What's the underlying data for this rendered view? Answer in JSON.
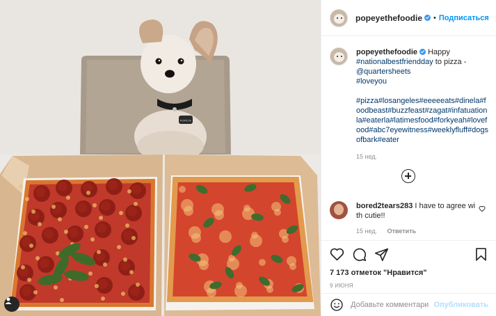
{
  "post": {
    "username": "popeyethefoodie",
    "separator": "•",
    "follow_label": "Подписаться",
    "collar_tag_text": "POPEYE"
  },
  "caption": {
    "username": "popeyethefoodie",
    "text_1": "Happy",
    "tag_1": "#nationalbestfriendday",
    "text_2": "to pizza -",
    "mention": "@quartersheets",
    "tag_2": "#loveyou",
    "hashtags": "#pizza#losangeles#eeeeeats#dinela#foodbeast#buzzfeast#zagat#infatuationla#eaterla#latimesfood#forkyeah#lovefood#abc7eyewitness#weeklyfluff#dogsofbark#eater",
    "age": "15 нед."
  },
  "comment": {
    "username": "bored2tears283",
    "text": "I have to agree with cutie!!",
    "age": "15 нед.",
    "reply_label": "Ответить"
  },
  "stats": {
    "likes": "7 173 отметок \"Нравится\"",
    "date": "9 ИЮНЯ"
  },
  "add_comment": {
    "placeholder": "Добавьте комментарий...",
    "publish_label": "Опубликовать"
  },
  "colors": {
    "accent": "#0095f6",
    "verified": "#3897f0",
    "link": "#00376b",
    "muted": "#8e8e8e"
  },
  "icons": [
    "user-tag-icon",
    "verified-icon",
    "load-more-comments-icon",
    "heart-icon",
    "like-icon",
    "comment-icon",
    "share-icon",
    "save-icon",
    "emoji-icon"
  ]
}
